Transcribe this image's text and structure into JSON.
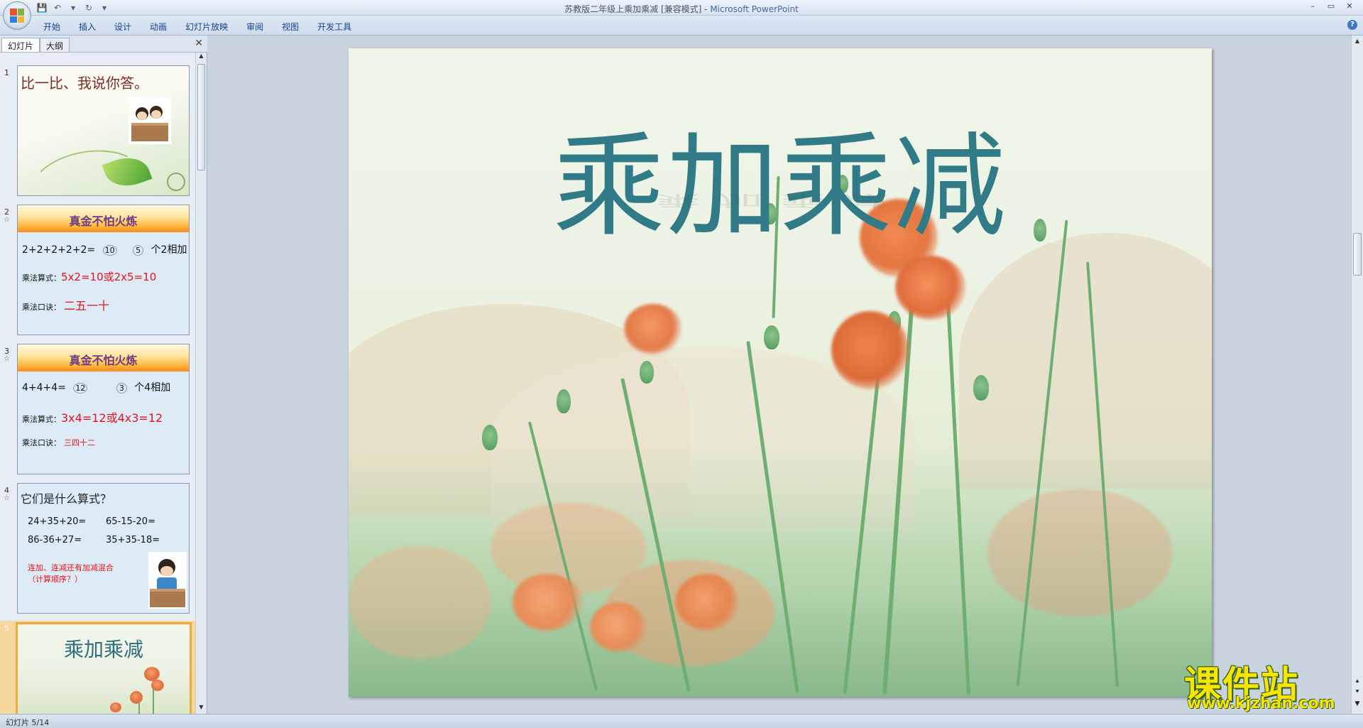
{
  "window": {
    "doc_title": "苏教版二年级上乘加乘减 [兼容模式]",
    "separator": " - ",
    "app_name": "Microsoft PowerPoint",
    "controls": [
      "–",
      "▭",
      "✕"
    ]
  },
  "qat": [
    "💾",
    "↶",
    "▾",
    "↻",
    "▾"
  ],
  "ribbon": {
    "tabs": [
      "开始",
      "插入",
      "设计",
      "动画",
      "幻灯片放映",
      "审阅",
      "视图",
      "开发工具"
    ],
    "help": "?"
  },
  "pane": {
    "tab_slides": "幻灯片",
    "tab_outline": "大纲",
    "close": "✕"
  },
  "slides": [
    {
      "num": "1",
      "title": "比一比、我说你答。"
    },
    {
      "num": "2",
      "star": "☆",
      "banner": "真金不怕火炼",
      "line1": "2+2+2+2+2=",
      "line1_a": "10",
      "line1_b": "5",
      "line1_c": "个2相加",
      "formula_label": "乘法算式：",
      "formula": "5x2=10或2x5=10",
      "rhyme_label": "乘法口诀：",
      "rhyme": "二五一十"
    },
    {
      "num": "3",
      "star": "☆",
      "banner": "真金不怕火炼",
      "line1": "4+4+4=",
      "line1_a": "12",
      "line1_b": "3",
      "line1_c": "个4相加",
      "formula_label": "乘法算式：",
      "formula": "3x4=12或4x3=12",
      "rhyme_label": "乘法口诀：",
      "rhyme": "三四十二"
    },
    {
      "num": "4",
      "star": "☆",
      "title": "它们是什么算式？",
      "eq1": "24+35+20=",
      "eq2": "65-15-20=",
      "eq3": "86-36+27=",
      "eq4": "35+35-18=",
      "note1": "连加、连减还有加减混合",
      "note2": "（计算顺序？）"
    },
    {
      "num": "5",
      "title": "乘加乘减"
    }
  ],
  "main_slide": {
    "title": "乘加乘减"
  },
  "status": {
    "slide_text": "幻灯片 5/14"
  },
  "watermark": {
    "main": "课件站",
    "url": "www.kjzhan.com"
  },
  "colors": {
    "accent": "#3e69a6",
    "title_teal": "#317a87",
    "red": "#e8141b",
    "selected": "#f4a73c"
  }
}
